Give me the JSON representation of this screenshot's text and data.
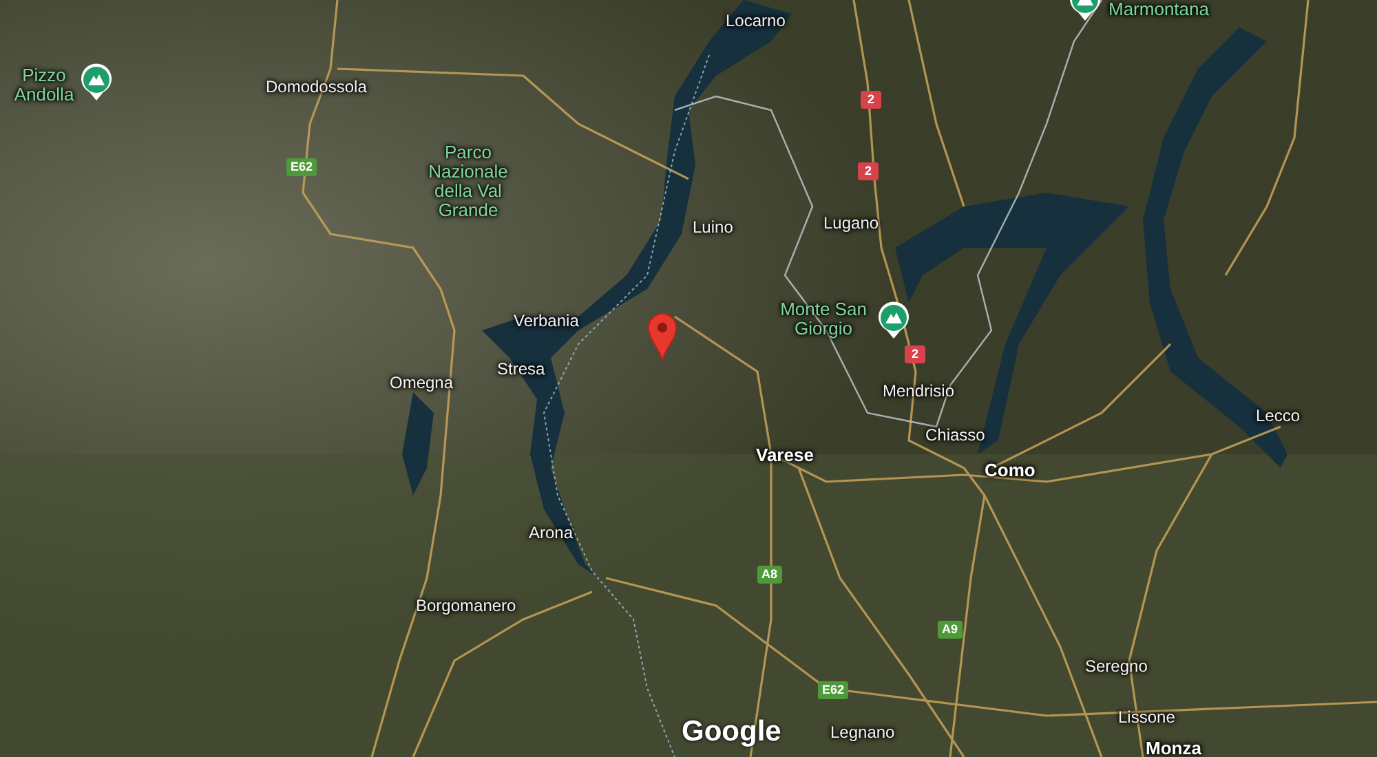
{
  "places": [
    {
      "name": "Pizzo Andolla",
      "kind": "peak"
    },
    {
      "name": "Marmontana",
      "kind": "peak"
    },
    {
      "name": "Domodossola",
      "kind": "city"
    },
    {
      "name": "Parco Nazionale della Val Grande",
      "kind": "park"
    },
    {
      "name": "Locarno",
      "kind": "city"
    },
    {
      "name": "Luino",
      "kind": "city"
    },
    {
      "name": "Lugano",
      "kind": "city"
    },
    {
      "name": "Verbania",
      "kind": "city"
    },
    {
      "name": "Monte San Giorgio",
      "kind": "peak"
    },
    {
      "name": "Stresa",
      "kind": "city"
    },
    {
      "name": "Omegna",
      "kind": "city"
    },
    {
      "name": "Arona",
      "kind": "city"
    },
    {
      "name": "Borgomanero",
      "kind": "city"
    },
    {
      "name": "Mendrisio",
      "kind": "city"
    },
    {
      "name": "Chiasso",
      "kind": "city"
    },
    {
      "name": "Varese",
      "kind": "major"
    },
    {
      "name": "Como",
      "kind": "major"
    },
    {
      "name": "Lecco",
      "kind": "city"
    },
    {
      "name": "Seregno",
      "kind": "city"
    },
    {
      "name": "Lissone",
      "kind": "city"
    },
    {
      "name": "Legnano",
      "kind": "city"
    },
    {
      "name": "Monza",
      "kind": "major"
    }
  ],
  "road_shields": [
    {
      "label": "E62",
      "kind": "european"
    },
    {
      "label": "2",
      "kind": "swiss"
    },
    {
      "label": "2",
      "kind": "swiss"
    },
    {
      "label": "2",
      "kind": "swiss"
    },
    {
      "label": "A8",
      "kind": "european"
    },
    {
      "label": "A9",
      "kind": "european"
    },
    {
      "label": "E62",
      "kind": "european"
    }
  ],
  "logo": "Google"
}
